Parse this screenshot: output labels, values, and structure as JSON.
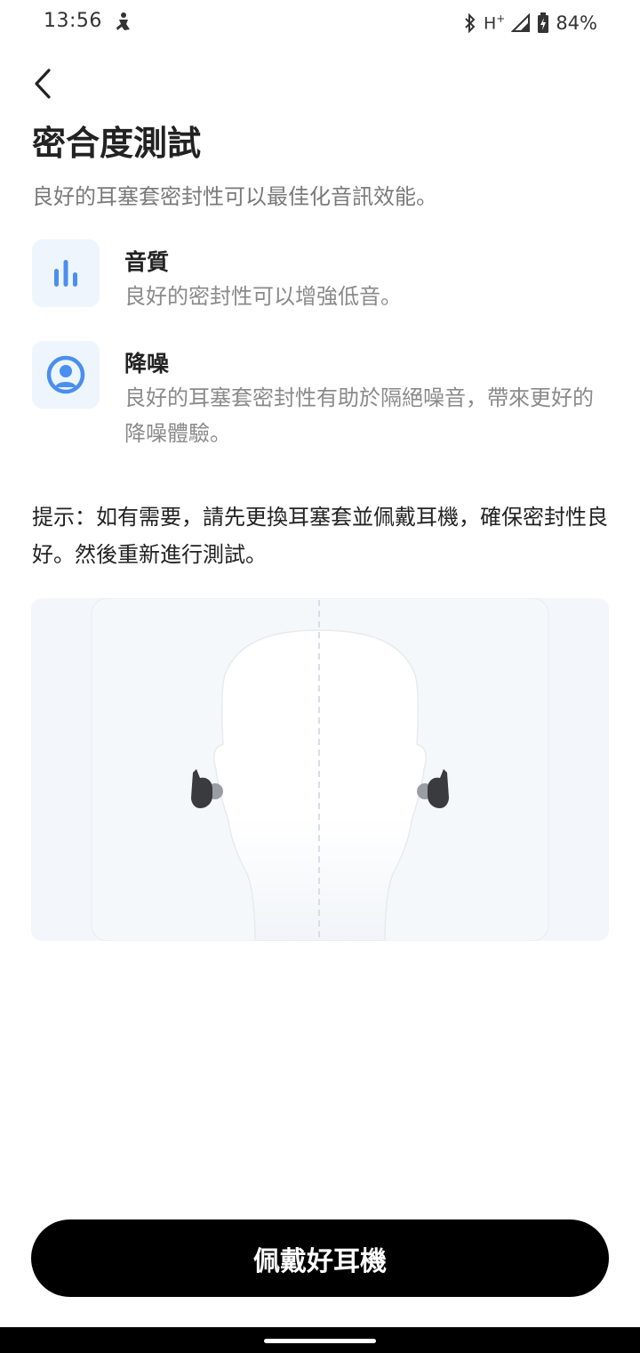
{
  "status_bar": {
    "time": "13:56",
    "app_icon": "accessibility-figure-icon",
    "bluetooth_icon": "bluetooth-icon",
    "network": "H",
    "network_sup": "+",
    "signal_icon": "cell-signal-icon",
    "battery_icon": "battery-charging-icon",
    "battery": "84%"
  },
  "header": {
    "back_icon": "chevron-left-icon",
    "title": "密合度測試",
    "subtitle": "良好的耳塞套密封性可以最佳化音訊效能。"
  },
  "features": [
    {
      "icon": "bar-chart-icon",
      "title": "音質",
      "description": "良好的密封性可以增強低音。"
    },
    {
      "icon": "person-noise-cancel-icon",
      "title": "降噪",
      "description": "良好的耳塞套密封性有助於隔絕噪音，帶來更好的降噪體驗。"
    }
  ],
  "hint": "提示：如有需要，請先更換耳塞套並佩戴耳機，確保密封性良好。然後重新進行測試。",
  "illustration": {
    "icon": "head-with-earbuds-illustration"
  },
  "primary_button": {
    "label": "佩戴好耳機"
  },
  "colors": {
    "accent_blue": "#4a8ff0",
    "icon_bg": "#eef5fc",
    "button_bg": "#000000",
    "illustration_bg": "#f3f6fa"
  }
}
